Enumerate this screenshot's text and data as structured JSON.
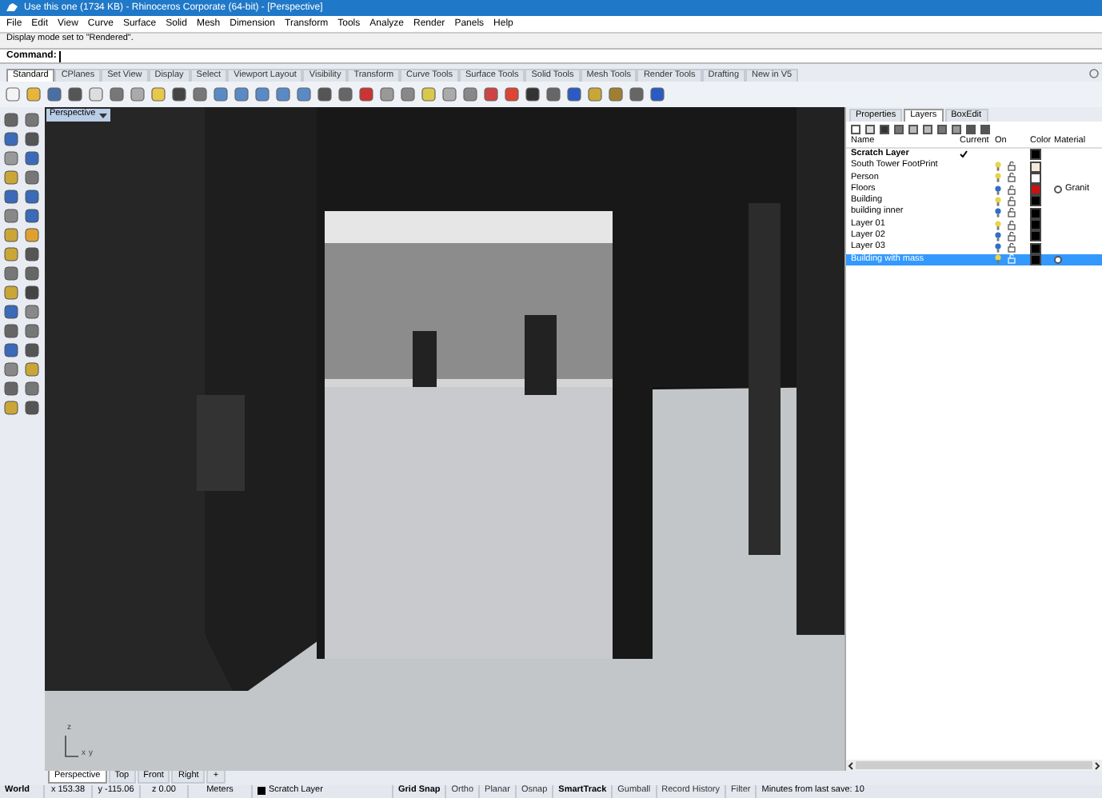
{
  "window": {
    "title": "Use this one (1734 KB) - Rhinoceros Corporate (64-bit) - [Perspective]"
  },
  "menu": [
    "File",
    "Edit",
    "View",
    "Curve",
    "Surface",
    "Solid",
    "Mesh",
    "Dimension",
    "Transform",
    "Tools",
    "Analyze",
    "Render",
    "Panels",
    "Help"
  ],
  "command_history": "Display mode set to \"Rendered\".",
  "command_prompt": "Command:",
  "toolbar_tabs": [
    {
      "label": "Standard",
      "selected": true
    },
    {
      "label": "CPlanes",
      "selected": false
    },
    {
      "label": "Set View",
      "selected": false
    },
    {
      "label": "Display",
      "selected": false
    },
    {
      "label": "Select",
      "selected": false
    },
    {
      "label": "Viewport Layout",
      "selected": false
    },
    {
      "label": "Visibility",
      "selected": false
    },
    {
      "label": "Transform",
      "selected": false
    },
    {
      "label": "Curve Tools",
      "selected": false
    },
    {
      "label": "Surface Tools",
      "selected": false
    },
    {
      "label": "Solid Tools",
      "selected": false
    },
    {
      "label": "Mesh Tools",
      "selected": false
    },
    {
      "label": "Render Tools",
      "selected": false
    },
    {
      "label": "Drafting",
      "selected": false
    },
    {
      "label": "New in V5",
      "selected": false
    }
  ],
  "viewport": {
    "title": "Perspective",
    "axis_labels": [
      "z",
      "x",
      "y"
    ]
  },
  "viewport_tabs": [
    {
      "label": "Perspective",
      "selected": true
    },
    {
      "label": "Top",
      "selected": false
    },
    {
      "label": "Front",
      "selected": false
    },
    {
      "label": "Right",
      "selected": false
    },
    {
      "label": "+",
      "selected": false
    }
  ],
  "panel": {
    "tabs": [
      {
        "label": "Properties",
        "selected": false
      },
      {
        "label": "Layers",
        "selected": true
      },
      {
        "label": "BoxEdit",
        "selected": false
      }
    ],
    "columns": [
      "Name",
      "Current",
      "On",
      "Color",
      "Material"
    ],
    "layers": [
      {
        "kind": "scratch",
        "name": "Scratch Layer",
        "current": true,
        "color": "#000000",
        "material_assigned": false,
        "selected": false
      },
      {
        "kind": "layer",
        "name": "South Tower FootPrint",
        "current": false,
        "lit": true,
        "color": "#f4e8d8",
        "material_assigned": false,
        "selected": false
      },
      {
        "kind": "layer",
        "name": "Person",
        "current": false,
        "lit": true,
        "color": "#ffffff",
        "material_assigned": false,
        "selected": false
      },
      {
        "kind": "layer",
        "name": "Floors",
        "current": false,
        "lit": false,
        "color": "#cc1111",
        "material_assigned": true,
        "material": "Granit",
        "selected": false
      },
      {
        "kind": "layer",
        "name": "Building",
        "current": false,
        "lit": true,
        "color": "#000000",
        "material_assigned": false,
        "selected": false
      },
      {
        "kind": "layer",
        "name": "building inner",
        "current": false,
        "lit": false,
        "color": "#000000",
        "material_assigned": false,
        "selected": false
      },
      {
        "kind": "layer",
        "name": "Layer 01",
        "current": false,
        "lit": true,
        "color": "#000000",
        "material_assigned": false,
        "selected": false
      },
      {
        "kind": "layer",
        "name": "Layer 02",
        "current": false,
        "lit": false,
        "color": "#000000",
        "material_assigned": false,
        "selected": false
      },
      {
        "kind": "layer",
        "name": "Layer 03",
        "current": false,
        "lit": false,
        "color": "#000000",
        "material_assigned": false,
        "selected": false
      },
      {
        "kind": "layer",
        "name": "Building with mass",
        "current": false,
        "lit": true,
        "color": "#000000",
        "material_assigned": true,
        "selected": true
      }
    ]
  },
  "status_bar": {
    "cplane": "World",
    "x": "x 153.38",
    "y": "y -115.06",
    "z": "z 0.00",
    "units": "Meters",
    "layer": "Scratch Layer",
    "toggles": [
      {
        "label": "Grid Snap",
        "on": true
      },
      {
        "label": "Ortho",
        "on": false
      },
      {
        "label": "Planar",
        "on": false
      },
      {
        "label": "Osnap",
        "on": false
      },
      {
        "label": "SmartTrack",
        "on": true
      },
      {
        "label": "Gumball",
        "on": false
      },
      {
        "label": "Record History",
        "on": false
      },
      {
        "label": "Filter",
        "on": false
      }
    ],
    "save_info": "Minutes from last save: 10"
  }
}
